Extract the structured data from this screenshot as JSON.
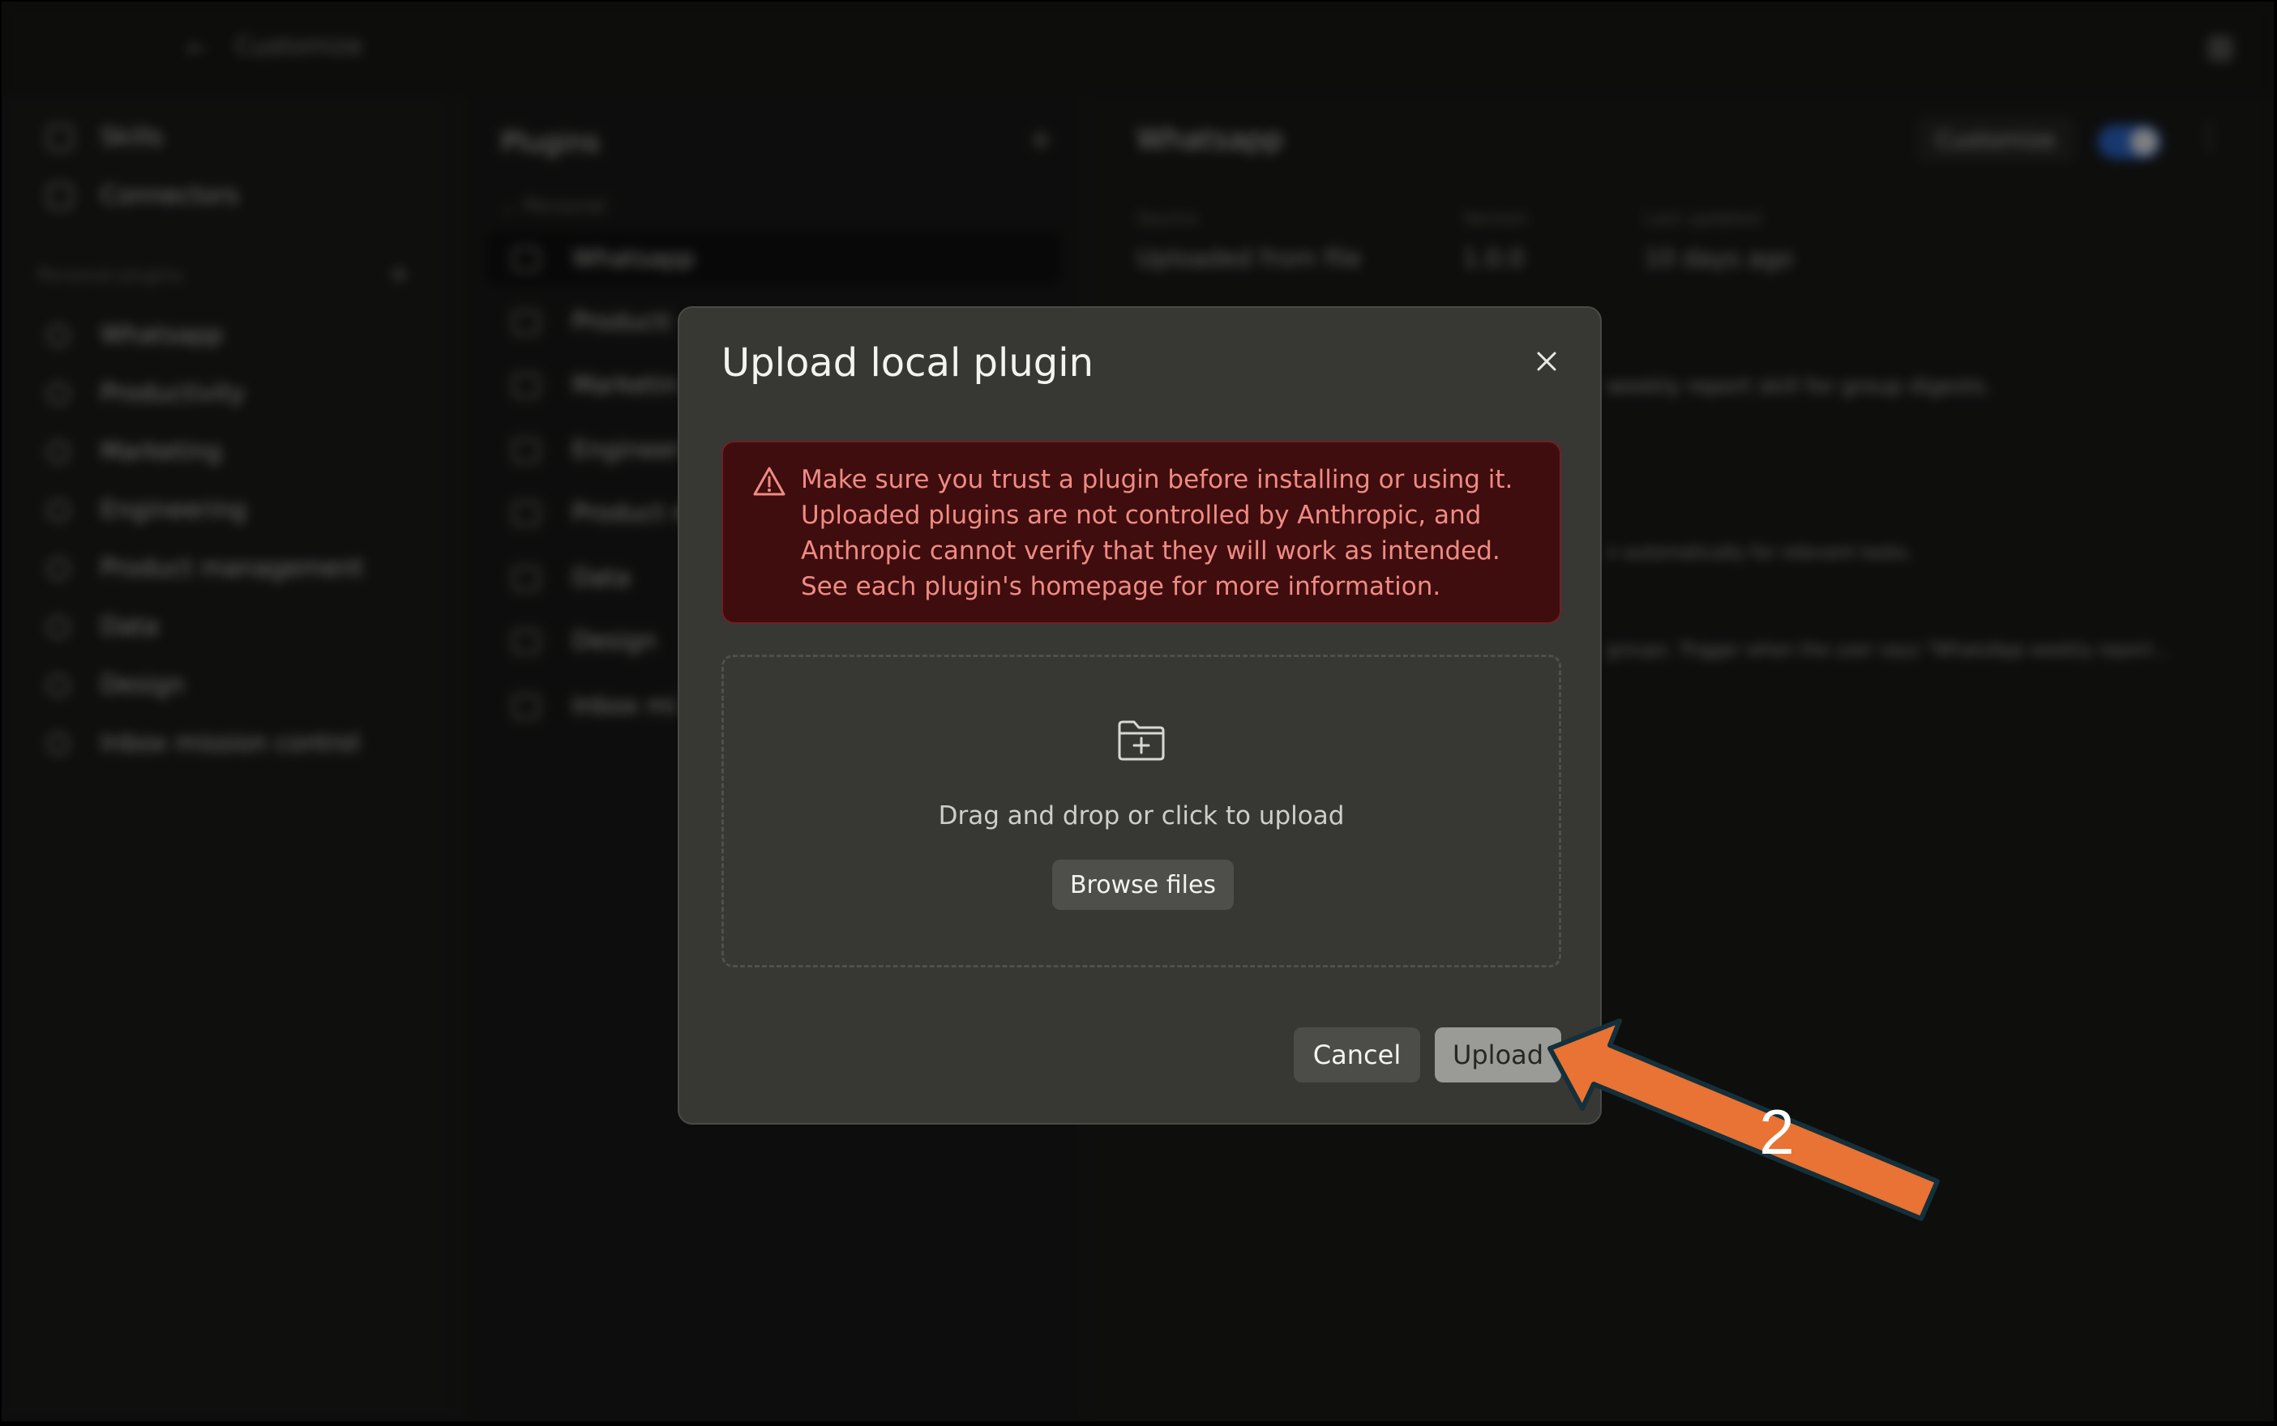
{
  "background": {
    "breadcrumb": "Customize",
    "sidebar": {
      "items": [
        {
          "label": "Skills",
          "icon": "skills-icon"
        },
        {
          "label": "Connectors",
          "icon": "connectors-icon"
        }
      ],
      "section_label": "Personal plugins",
      "plugins": [
        "Whatsapp",
        "Productivity",
        "Marketing",
        "Engineering",
        "Product management",
        "Data",
        "Design",
        "Inbox mission control"
      ]
    },
    "plugins_panel": {
      "title": "Plugins",
      "group": "Personal",
      "items": [
        "Whatsapp",
        "Producti",
        "Marketin",
        "Engineer",
        "Product m",
        "Data",
        "Design",
        "Inbox mi"
      ]
    },
    "detail": {
      "title": "Whatsapp",
      "customize_label": "Customize",
      "toggle_on": true,
      "meta": {
        "source_label": "Source",
        "source_value": "Uploaded from file",
        "version_label": "Version",
        "version_value": "1.0.0",
        "updated_label": "Last updated",
        "updated_value": "10 days ago"
      },
      "desc_1": "weekly report skill for group digests.",
      "desc_2": "n automatically for relevant tasks.",
      "desc_3": "groups. Trigger when the user says \"WhatsApp weekly report..."
    }
  },
  "modal": {
    "title": "Upload local plugin",
    "warning": "Make sure you trust a plugin before installing or using it. Uploaded plugins are not controlled by Anthropic, and Anthropic cannot verify that they will work as intended. See each plugin's homepage for more information.",
    "dropzone_text": "Drag and drop or click to upload",
    "browse_label": "Browse files",
    "cancel_label": "Cancel",
    "upload_label": "Upload"
  },
  "annotation": {
    "step_number": "2",
    "arrow_color": "#e87334"
  }
}
